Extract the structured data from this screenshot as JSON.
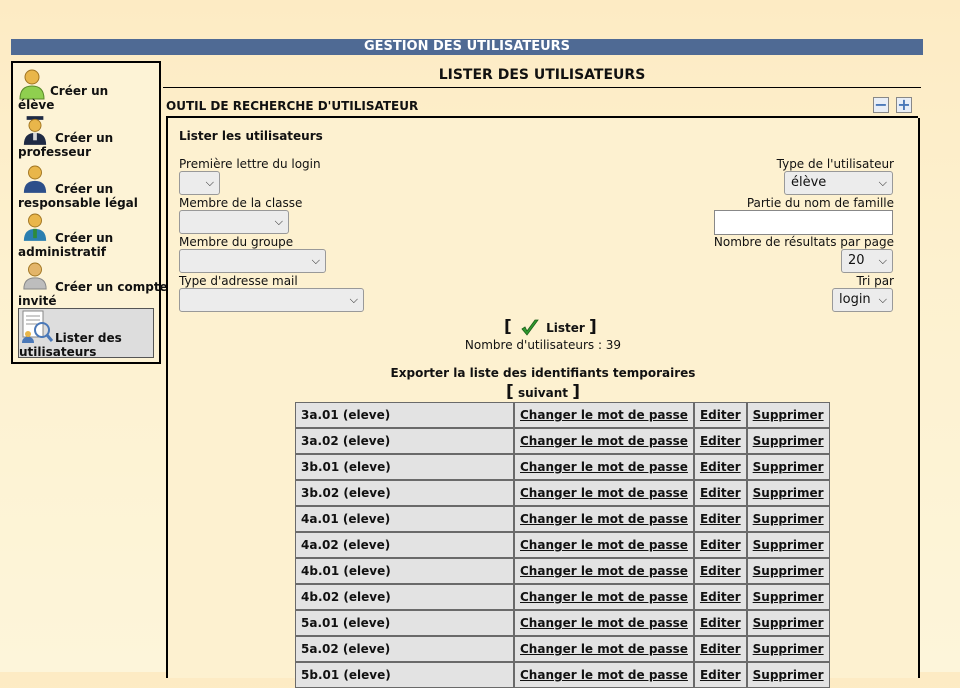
{
  "page": {
    "title": "GESTION DES UTILISATEURS",
    "subtitle": "LISTER DES UTILISATEURS"
  },
  "sidebar": {
    "items": [
      {
        "line1": "Créer un",
        "line2": "élève",
        "icon": "student-icon"
      },
      {
        "line1": "Créer un",
        "line2": "professeur",
        "icon": "teacher-icon"
      },
      {
        "line1": "Créer un",
        "line2": "responsable légal",
        "icon": "parent-icon"
      },
      {
        "line1": "Créer un",
        "line2": "administratif",
        "icon": "admin-icon"
      },
      {
        "line1": "Créer un compte",
        "line2": "invité",
        "icon": "guest-icon"
      },
      {
        "line1": "Lister des",
        "line2": "utilisateurs",
        "icon": "list-users-icon",
        "active": true
      }
    ]
  },
  "tool": {
    "header": "OUTIL DE RECHERCHE D'UTILISATEUR",
    "minus": "−",
    "plus": "+",
    "section_title": "Lister les utilisateurs",
    "fields": {
      "first_letter_label": "Première lettre du login",
      "first_letter_value": "",
      "class_label": "Membre de la classe",
      "class_value": "",
      "group_label": "Membre du groupe",
      "group_value": "",
      "mail_type_label": "Type d'adresse mail",
      "mail_type_value": "",
      "user_type_label": "Type de l'utilisateur",
      "user_type_value": "élève",
      "name_part_label": "Partie du nom de famille",
      "name_part_value": "",
      "results_label": "Nombre de résultats par page",
      "results_value": "20",
      "sort_label": "Tri par",
      "sort_value": "login"
    },
    "bracket_open": "[",
    "bracket_close": "]",
    "lister_label": "Lister",
    "count_text": "Nombre d'utilisateurs : 39",
    "export_text": "Exporter la liste des identifiants temporaires",
    "suivant_label": "suivant"
  },
  "table": {
    "change_label": "Changer le mot de passe",
    "edit_label": "Editer",
    "delete_label": "Supprimer",
    "rows": [
      "3a.01 (eleve)",
      "3a.02 (eleve)",
      "3b.01 (eleve)",
      "3b.02 (eleve)",
      "4a.01 (eleve)",
      "4a.02 (eleve)",
      "4b.01 (eleve)",
      "4b.02 (eleve)",
      "5a.01 (eleve)",
      "5a.02 (eleve)",
      "5b.01 (eleve)"
    ]
  }
}
